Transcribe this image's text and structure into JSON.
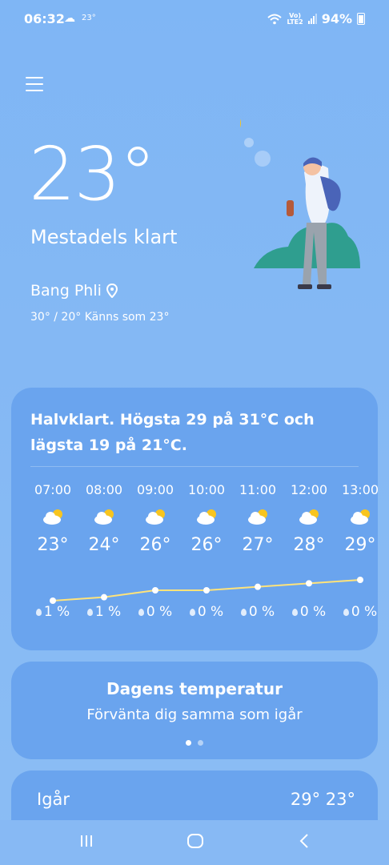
{
  "status_bar": {
    "time": "06:32",
    "weather_icon": "cloud-icon",
    "temp": "23°",
    "network_top": "Vo)",
    "network_bottom": "LTE2",
    "battery": "94%"
  },
  "current": {
    "temperature": "23°",
    "condition": "Mestadels klart",
    "location": "Bang Phli",
    "range": "30° / 20° Känns som 23°"
  },
  "hourly": {
    "summary": "Halvklart. Högsta 29 på 31°C och lägsta 19 på 21°C.",
    "hours": [
      {
        "time": "07:00",
        "temp": "23°",
        "rain": "1 %",
        "value": 23
      },
      {
        "time": "08:00",
        "temp": "24°",
        "rain": "1 %",
        "value": 24
      },
      {
        "time": "09:00",
        "temp": "26°",
        "rain": "0 %",
        "value": 26
      },
      {
        "time": "10:00",
        "temp": "26°",
        "rain": "0 %",
        "value": 26
      },
      {
        "time": "11:00",
        "temp": "27°",
        "rain": "0 %",
        "value": 27
      },
      {
        "time": "12:00",
        "temp": "28°",
        "rain": "0 %",
        "value": 28
      },
      {
        "time": "13:00",
        "temp": "29°",
        "rain": "0 %",
        "value": 29
      }
    ]
  },
  "today_card": {
    "title": "Dagens temperatur",
    "subtitle": "Förvänta dig samma som igår",
    "page_count": 2,
    "active_page": 0
  },
  "yesterday": {
    "label": "Igår",
    "temps": "29° 23°"
  },
  "colors": {
    "sun": "#f8c51e",
    "graph_line": "#ffe37a",
    "card": "#6aa4ee"
  }
}
